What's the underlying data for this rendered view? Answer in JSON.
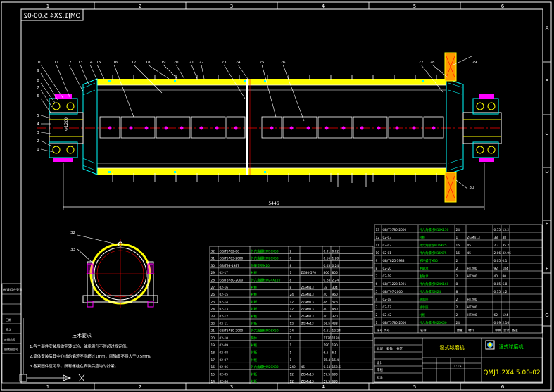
{
  "drawing": {
    "title_box_text": "QMJ1.2X4.5.00-02",
    "drawing_number": "QMJ1.2X4.5.00-02",
    "drawing_name": "湿式球磨机",
    "length_dimension": "5446",
    "diameter_dimension": "Φ1200"
  },
  "grid": {
    "columns": [
      "1",
      "2",
      "3",
      "4",
      "5",
      "6"
    ],
    "rows": [
      "A",
      "B",
      "C",
      "D",
      "E",
      "F",
      "G"
    ]
  },
  "part_callouts": [
    "1",
    "2",
    "3",
    "4",
    "5",
    "6",
    "7",
    "8",
    "9",
    "10",
    "11",
    "12",
    "13",
    "14",
    "15",
    "16",
    "17",
    "18",
    "19",
    "20",
    "21",
    "22",
    "23",
    "24",
    "25",
    "26",
    "27",
    "28",
    "29",
    "30"
  ],
  "section_callouts": [
    "32",
    "33"
  ],
  "notes": {
    "heading": "技术要求",
    "lines": [
      "1.各个部件安装后做空转试验，轴承温升不得超过规定值。",
      "2.筒体安装后其中心线的偏差不得超过1mm，同轴度不得大于0.5mm。",
      "3.各紧固件应可靠，所有螺栓在安装后应均匀拧紧。"
    ]
  },
  "bom_left": {
    "rows": [
      [
        "32",
        "GB/T5782-86",
        "外六角螺栓M16X50",
        "2",
        "",
        "0.01",
        "0.02",
        ""
      ],
      [
        "31",
        "GB/T5783-2000",
        "外六角螺栓M20X60",
        "8",
        "",
        "0.16",
        "1.28",
        ""
      ],
      [
        "30",
        "GB/T93-1987",
        "弹簧垫圈M20",
        "8",
        "",
        "0.03",
        "0.24",
        ""
      ],
      [
        "29",
        "02-17",
        "衬板",
        "1",
        "ZG30-570",
        "806",
        "806",
        ""
      ],
      [
        "28",
        "GB/T5780-2000",
        "外六角螺栓M24X110",
        "8",
        "",
        "0.28",
        "2.24",
        ""
      ],
      [
        "27",
        "02-16",
        "衬板",
        "8",
        "ZGMn13",
        "38",
        "304",
        ""
      ],
      [
        "26",
        "02-15",
        "衬板",
        "24",
        "ZGMn13",
        "40",
        "960",
        ""
      ],
      [
        "25",
        "02-14",
        "衬板",
        "12",
        "ZGMn13",
        "48",
        "576",
        ""
      ],
      [
        "24",
        "02-13",
        "衬板",
        "12",
        "ZGMn13",
        "40",
        "480",
        ""
      ],
      [
        "23",
        "02-12",
        "衬板",
        "8",
        "ZGMn13",
        "40",
        "320",
        ""
      ],
      [
        "22",
        "02-11",
        "衬板",
        "12",
        "ZGMn13",
        "36.5",
        "438",
        ""
      ],
      [
        "21",
        "GB/T5780-2000",
        "外六角螺栓M16X50",
        "24",
        "",
        "0.51",
        "12.24",
        ""
      ],
      [
        "20",
        "02-10",
        "筒体",
        "1",
        "",
        "1130",
        "1130",
        ""
      ],
      [
        "19",
        "02-09",
        "衬板",
        "1",
        "",
        "190",
        "190",
        ""
      ],
      [
        "18",
        "02-08",
        "衬板",
        "1",
        "",
        "6.5",
        "6.5",
        ""
      ],
      [
        "17",
        "02-07",
        "衬板",
        "1",
        "",
        "15.4",
        "15.4",
        ""
      ],
      [
        "16",
        "02-06",
        "外六角螺栓M20X80",
        "240",
        "45",
        "0.64",
        "153.6",
        ""
      ],
      [
        "15",
        "02-05",
        "衬板",
        "12",
        "ZGMn13",
        "57.5",
        "690",
        ""
      ],
      [
        "14",
        "02-04",
        "衬板",
        "12",
        "ZGMn13",
        "57.5",
        "690",
        ""
      ]
    ]
  },
  "bom_right": {
    "rows": [
      [
        "13",
        "GB/T5780-2000",
        "外六角螺栓M16X150",
        "24",
        "",
        "0.55",
        "13.2",
        ""
      ],
      [
        "12",
        "02-03",
        "衬板",
        "1",
        "ZGMn13",
        "38",
        "38",
        ""
      ],
      [
        "11",
        "02-02",
        "外六角螺栓M16X75",
        "16",
        "45",
        "2.2",
        "35.2",
        ""
      ],
      [
        "10",
        "02-01",
        "外六角螺栓M16X75",
        "16",
        "45",
        "2.06",
        "32.96",
        ""
      ],
      [
        "9",
        "GB/T825-1988",
        "吊环螺钉M30",
        "2",
        "",
        "0.05",
        "0.1",
        ""
      ],
      [
        "8",
        "02-20",
        "主轴承",
        "2",
        "HT200",
        "92",
        "184",
        ""
      ],
      [
        "7",
        "02-19",
        "主轴承",
        "2",
        "HT200",
        "40",
        "80",
        ""
      ],
      [
        "6",
        "GB/T1228-1991",
        "外六角螺栓M24X160",
        "8",
        "",
        "0.85",
        "6.8",
        ""
      ],
      [
        "5",
        "GB/T97-2000",
        "外六角螺母M24",
        "8",
        "",
        "0.15",
        "1.2",
        ""
      ],
      [
        "4",
        "02-18",
        "轴承座",
        "2",
        "HT200",
        "",
        "",
        ""
      ],
      [
        "3",
        "02-17",
        "轴承座",
        "2",
        "HT200",
        "",
        "",
        ""
      ],
      [
        "2",
        "02-42",
        "衬板",
        "2",
        "HT200",
        "62",
        "124",
        ""
      ],
      [
        "1",
        "GB/T5780-2000",
        "外六角螺栓M20X50",
        "24",
        "",
        "0.09",
        "2.16",
        ""
      ]
    ],
    "header": [
      "序号",
      "代号",
      "名称",
      "数量",
      "材料",
      "单件",
      "总计",
      "备注"
    ]
  },
  "title_block": {
    "company": "湿式球磨机",
    "labels": [
      "标记",
      "处数",
      "分区",
      "更改文件号",
      "签名",
      "日期"
    ],
    "scale_values": [
      "1:15"
    ],
    "design_label": "设计",
    "check_label": "审核",
    "approve_label": "批准"
  },
  "left_stamp": {
    "labels": [
      "借(通)用件登记",
      "旧底图总号",
      "底图总号",
      "签字",
      "日期"
    ]
  },
  "colors": {
    "background": "#000000",
    "frame": "#ffffff",
    "shell": "#ffff00",
    "liner": "#ffffff",
    "centerline": "#ff0000",
    "bolt": "#ff00ff",
    "callout": "#ffffff",
    "hatch": "#00ffff",
    "dimension": "#ffffff",
    "bom_text": "#ffff00",
    "bom_name": "#00ff00"
  }
}
